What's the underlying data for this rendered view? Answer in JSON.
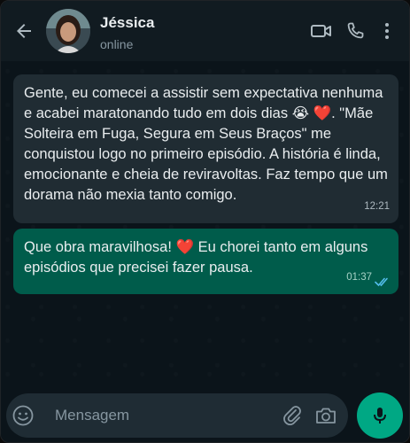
{
  "contact": {
    "name": "Jéssica",
    "status": "online"
  },
  "messages": [
    {
      "direction": "incoming",
      "parts": [
        "Gente, eu comecei a assistir sem expectativa nenhuma e acabei maratonando tudo em dois dias ",
        "😭",
        " ",
        "❤️",
        ". \"Mãe Solteira em Fuga, Segura em Seus Braços\" me conquistou logo no primeiro episódio. A história é linda, emocionante e cheia de reviravoltas. Faz tempo que um dorama não mexia tanto comigo."
      ],
      "time": "12:21"
    },
    {
      "direction": "outgoing",
      "parts": [
        "Que obra maravilhosa! ",
        "❤️",
        " Eu chorei tanto em alguns episódios que precisei fazer pausa."
      ],
      "time": "01:37",
      "read": true
    }
  ],
  "composer": {
    "placeholder": "Mensagem"
  },
  "icons": {
    "back": "arrow-left-icon",
    "video": "video-call-icon",
    "phone": "phone-icon",
    "menu": "more-vertical-icon",
    "emoji": "emoji-icon",
    "attach": "paperclip-icon",
    "camera": "camera-icon",
    "mic": "microphone-icon"
  },
  "colors": {
    "header_bg": "#111b21",
    "incoming_bubble": "#202c33",
    "outgoing_bubble": "#005c4b",
    "accent": "#00a884",
    "read_ticks": "#53bdeb"
  }
}
